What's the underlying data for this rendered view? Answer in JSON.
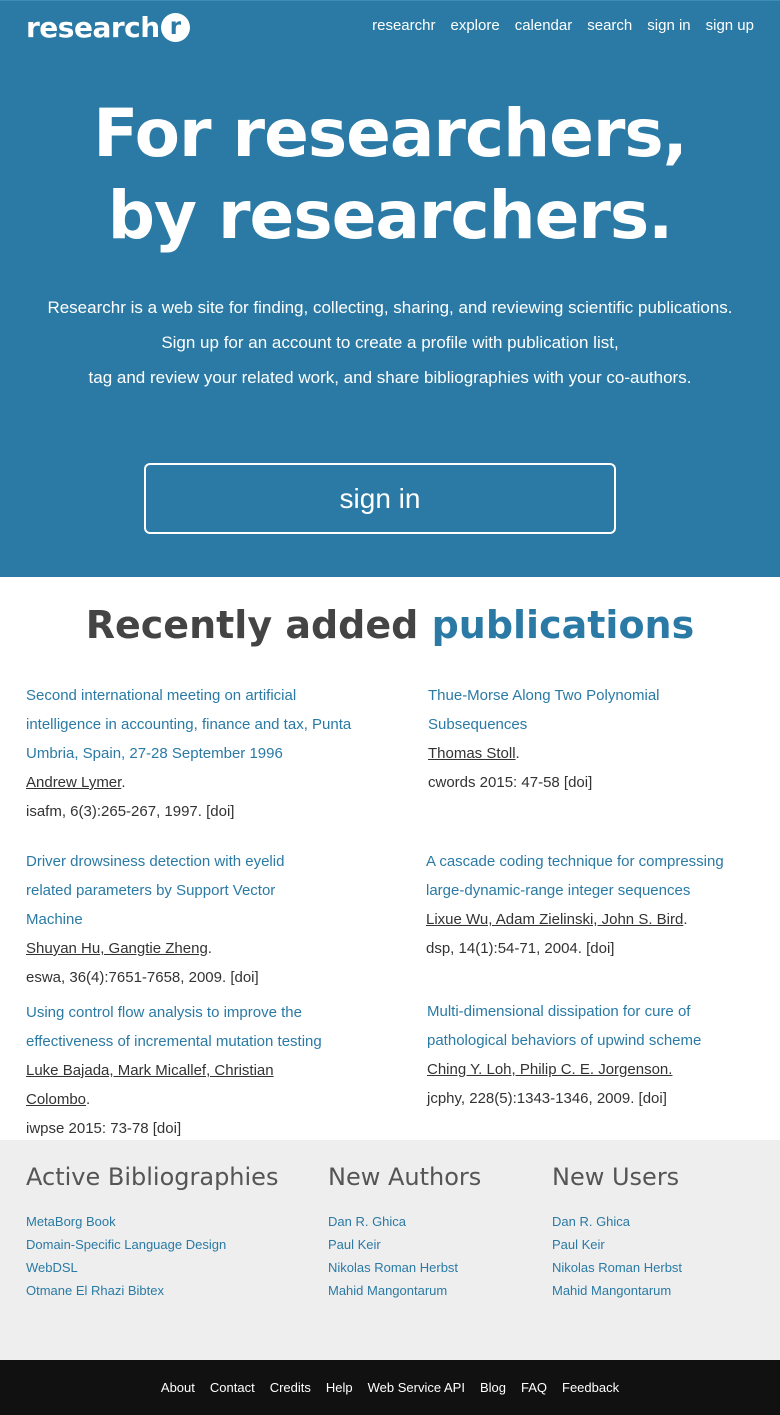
{
  "brand": {
    "logo_text": "research",
    "logo_badge": "r"
  },
  "topnav": [
    "researchr",
    "explore",
    "calendar",
    "search",
    "sign in",
    "sign up"
  ],
  "hero": {
    "headline_line1": "For researchers,",
    "headline_line2": "by researchers.",
    "intro_lines": [
      "Researchr is a web site for finding, collecting, sharing, and reviewing scientific publications.",
      "Sign up for an account to create a profile with publication list,",
      "tag and review your related work, and share bibliographies with your co-authors."
    ],
    "signin_label": "sign in"
  },
  "publications": {
    "title_prefix": "Recently added",
    "title_accent": "publications",
    "items": [
      {
        "title": "Second international meeting on artificial intelligence in accounting, finance and tax, Punta Umbria, Spain, 27-28 September 1996",
        "authors": "Andrew Lymer",
        "authors_suffix": ".",
        "venue": "isafm, 6(3):265-267, 1997.",
        "doi": "[doi]"
      },
      {
        "title": "Thue-Morse Along Two Polynomial Subsequences",
        "authors": "Thomas Stoll",
        "authors_suffix": ".",
        "venue": "cwords 2015: 47-58",
        "doi": "[doi]"
      },
      {
        "title": "Driver drowsiness detection with eyelid related parameters by Support Vector Machine",
        "authors": "Shuyan Hu, Gangtie Zheng",
        "authors_suffix": ".",
        "venue": "eswa, 36(4):7651-7658, 2009.",
        "doi": "[doi]"
      },
      {
        "title": "A cascade coding technique for compressing large-dynamic-range integer sequences",
        "authors": "Lixue Wu, Adam Zielinski, John S. Bird",
        "authors_suffix": ".",
        "venue": "dsp, 14(1):54-71, 2004.",
        "doi": "[doi]"
      },
      {
        "title": "Using control flow analysis to improve the effectiveness of incremental mutation testing",
        "authors": "Luke Bajada, Mark Micallef, Christian Colombo",
        "authors_suffix": ".",
        "venue": "iwpse 2015: 73-78",
        "doi": "[doi]"
      },
      {
        "title": "Multi-dimensional dissipation for cure of pathological behaviors of upwind scheme",
        "authors": "Ching Y. Loh, Philip C. E. Jorgenson.",
        "authors_suffix": "",
        "venue": "jcphy, 228(5):1343-1346, 2009.",
        "doi": "[doi]"
      }
    ]
  },
  "bibliographies": {
    "title": "Active Bibliographies",
    "items": [
      "MetaBorg Book",
      "Domain-Specific Language Design",
      "WebDSL",
      "Otmane El Rhazi Bibtex"
    ]
  },
  "new_authors": {
    "title": "New Authors",
    "items": [
      "Dan R. Ghica",
      "Paul Keir",
      "Nikolas Roman Herbst",
      "Mahid Mangontarum"
    ]
  },
  "new_users": {
    "title": "New Users",
    "items": [
      "Dan R. Ghica",
      "Paul Keir",
      "Nikolas Roman Herbst",
      "Mahid Mangontarum"
    ]
  },
  "footer": [
    "About",
    "Contact",
    "Credits",
    "Help",
    "Web Service API",
    "Blog",
    "FAQ",
    "Feedback"
  ],
  "colors": {
    "accent": "#2a7aa5",
    "footer_bg": "#111111",
    "lower_bg": "#eeeeee"
  }
}
